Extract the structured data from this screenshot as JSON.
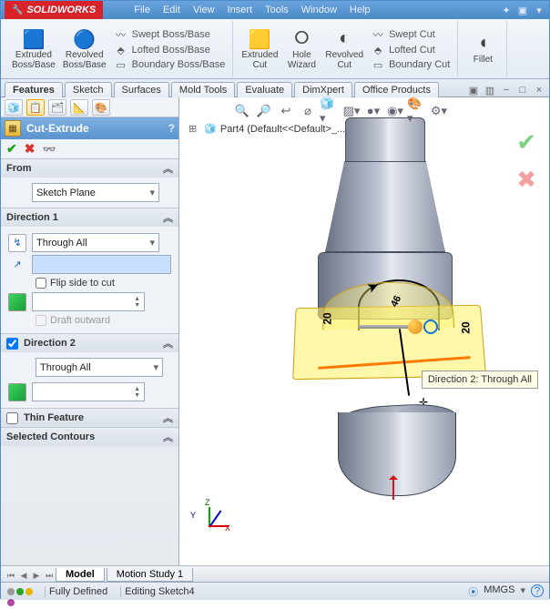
{
  "app": {
    "brand": "SOLIDWORKS"
  },
  "menu": [
    "File",
    "Edit",
    "View",
    "Insert",
    "Tools",
    "Window",
    "Help"
  ],
  "ribbon": {
    "extruded_boss": "Extruded\nBoss/Base",
    "revolved_boss": "Revolved\nBoss/Base",
    "swept_boss": "Swept Boss/Base",
    "lofted_boss": "Lofted Boss/Base",
    "boundary_boss": "Boundary Boss/Base",
    "extruded_cut": "Extruded\nCut",
    "hole_wizard": "Hole\nWizard",
    "revolved_cut": "Revolved\nCut",
    "swept_cut": "Swept Cut",
    "lofted_cut": "Lofted Cut",
    "boundary_cut": "Boundary Cut",
    "fillet": "Fillet"
  },
  "feature_tabs": [
    "Features",
    "Sketch",
    "Surfaces",
    "Mold Tools",
    "Evaluate",
    "DimXpert",
    "Office Products"
  ],
  "pm": {
    "title": "Cut-Extrude",
    "from": {
      "label": "From",
      "value": "Sketch Plane"
    },
    "dir1": {
      "label": "Direction 1",
      "end": "Through All",
      "flip": "Flip side to cut",
      "draft_outward": "Draft outward"
    },
    "dir2": {
      "label": "Direction 2",
      "end": "Through All"
    },
    "thin": {
      "label": "Thin Feature"
    },
    "sel": {
      "label": "Selected Contours"
    }
  },
  "viewport": {
    "part_label": "Part4 (Default<<Default>_...",
    "tooltip": "Direction 2: Through All",
    "dim20a": "20",
    "dim20b": "20",
    "dim46": "46",
    "axis_x": "X",
    "axis_y": "Y",
    "axis_z": "Z"
  },
  "doc_tabs": [
    "Model",
    "Motion Study 1"
  ],
  "status": {
    "fully_defined": "Fully Defined",
    "editing": "Editing Sketch4",
    "units": "MMGS"
  }
}
